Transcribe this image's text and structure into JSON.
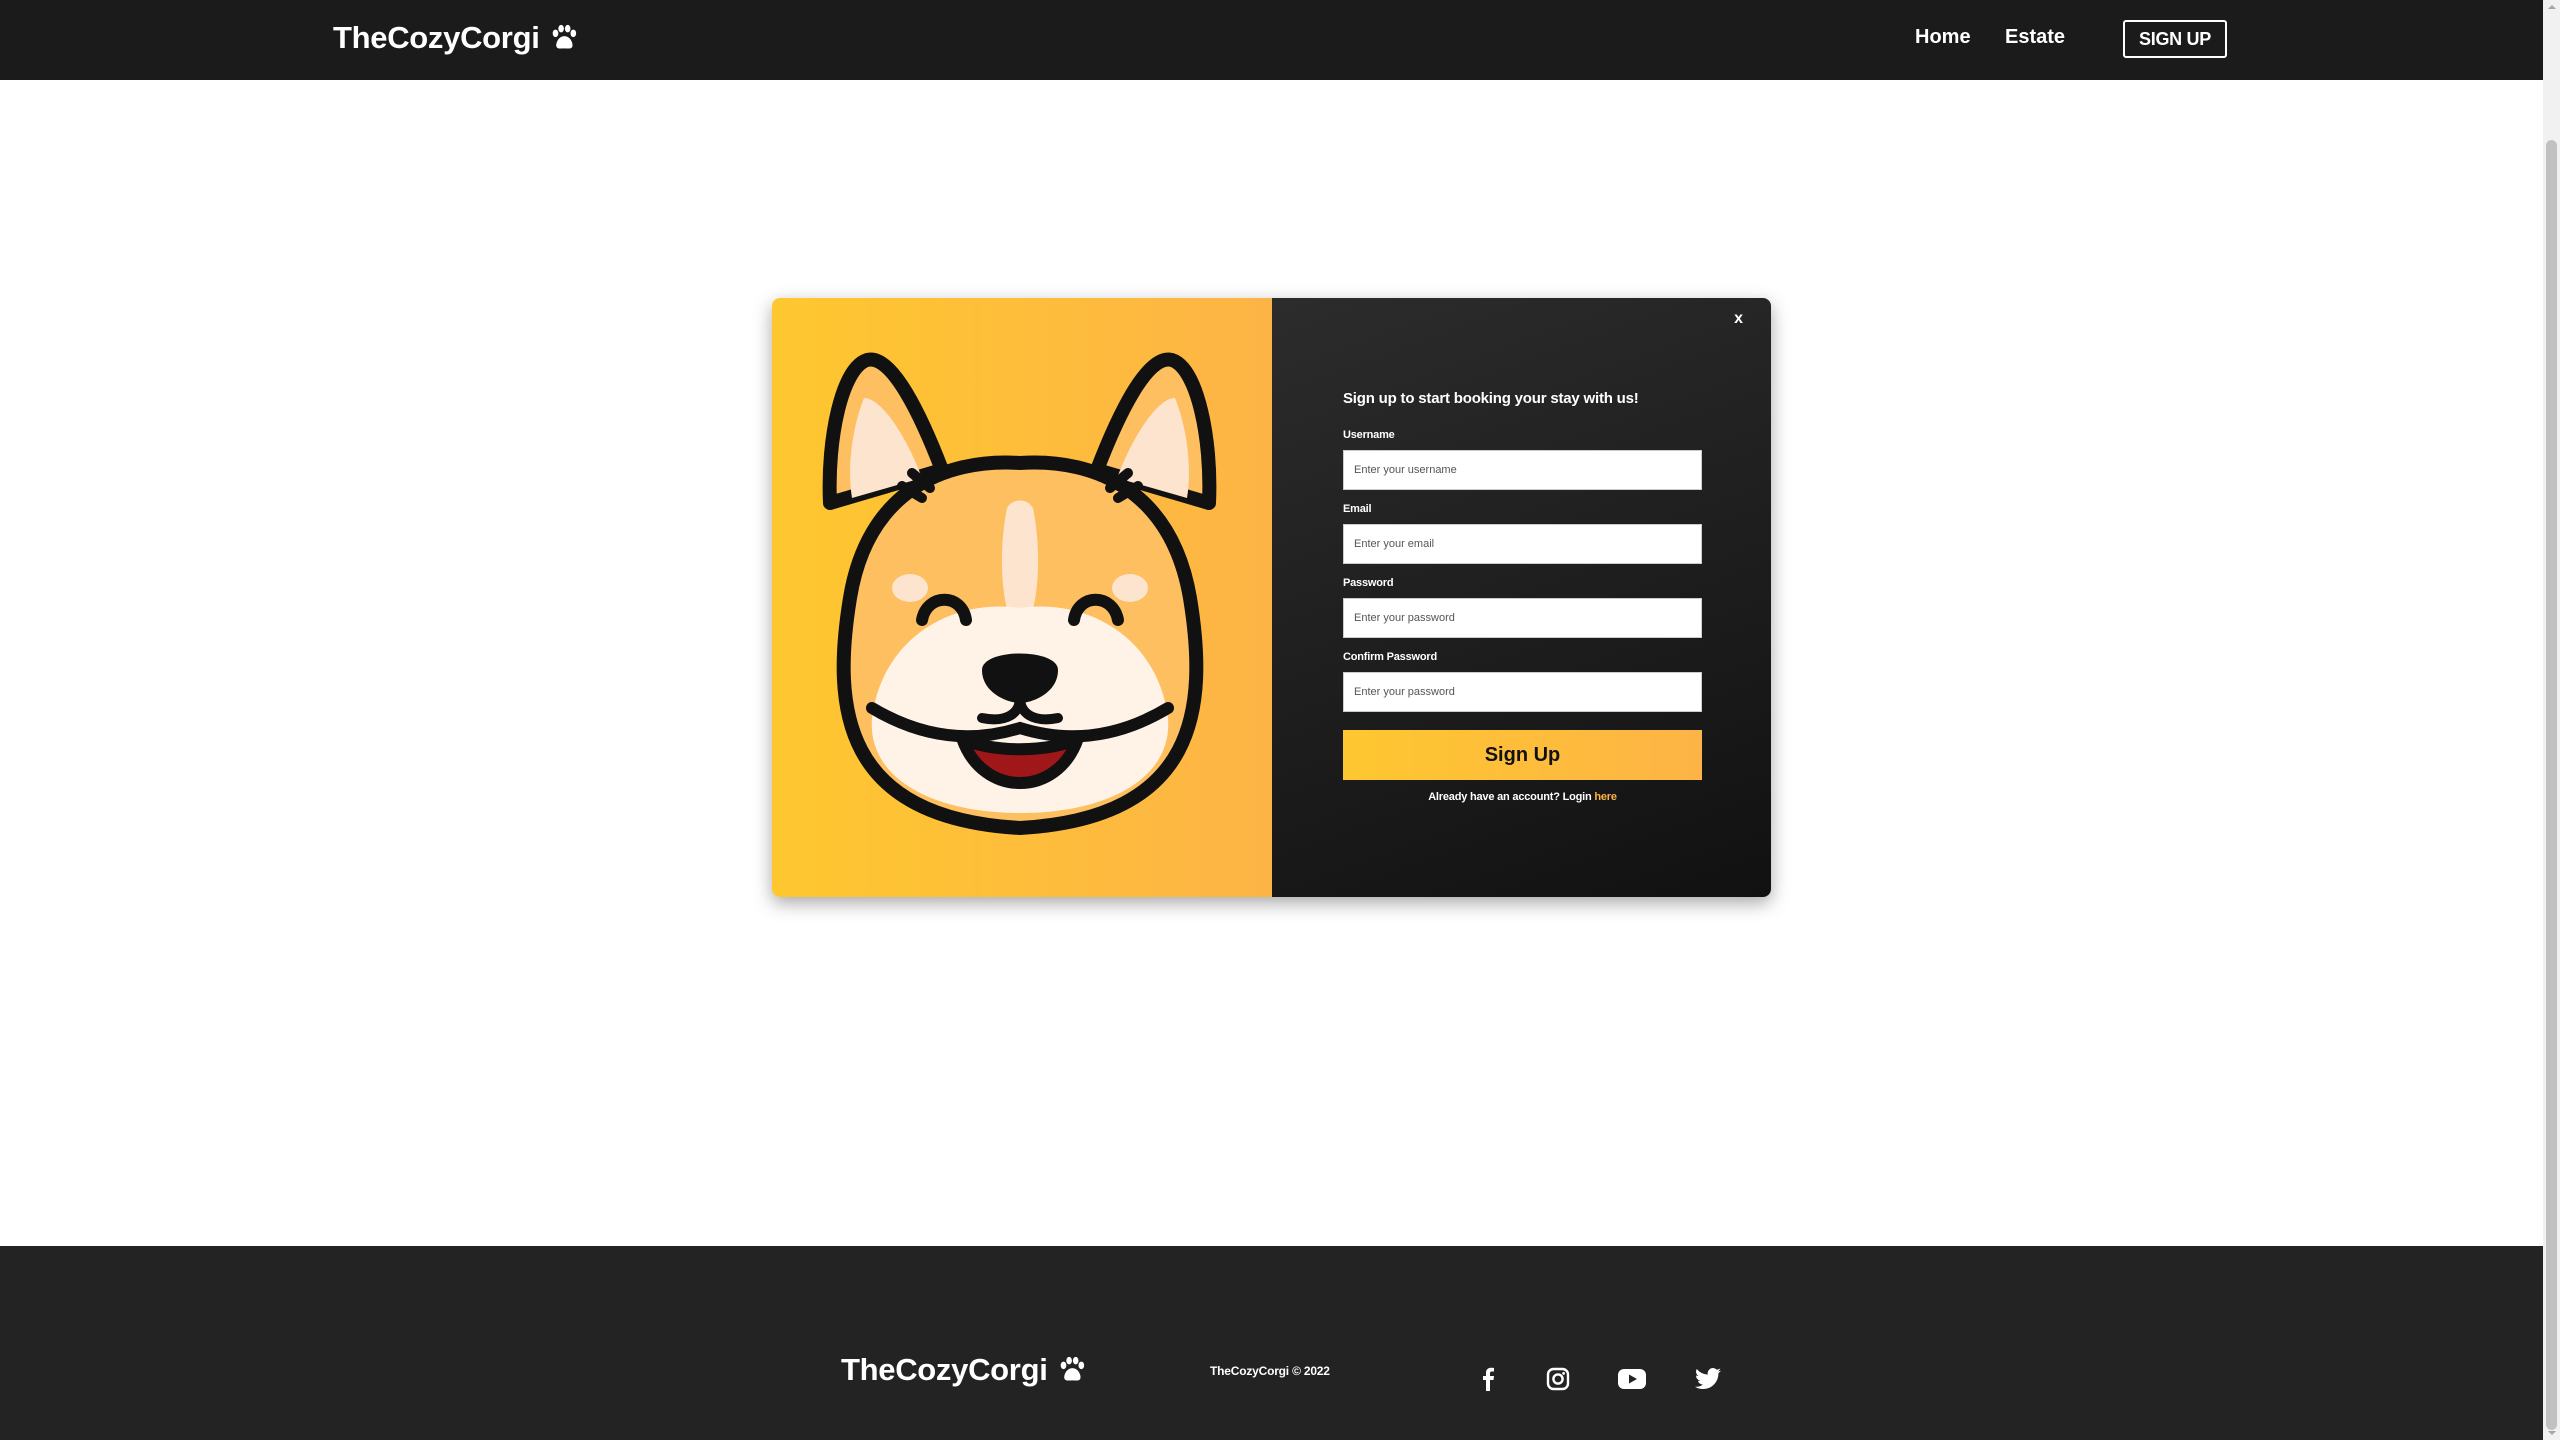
{
  "navbar": {
    "brand": "TheCozyCorgi",
    "links": [
      "Home",
      "Estate"
    ],
    "signup_label": "SIGN UP"
  },
  "modal": {
    "close_label": "x",
    "heading": "Sign up to start booking your stay with us!",
    "fields": [
      {
        "label": "Username",
        "placeholder": "Enter your username"
      },
      {
        "label": "Email",
        "placeholder": "Enter your email"
      },
      {
        "label": "Password",
        "placeholder": "Enter your password"
      },
      {
        "label": "Confirm Password",
        "placeholder": "Enter your password"
      }
    ],
    "submit_label": "Sign Up",
    "login_prompt": "Already have an account? Login",
    "login_link": "here"
  },
  "footer": {
    "brand": "TheCozyCorgi",
    "copyright": "TheCozyCorgi © 2022",
    "social_icons": [
      "facebook-icon",
      "instagram-icon",
      "youtube-icon",
      "twitter-icon"
    ]
  },
  "colors": {
    "accent_yellow": "#fec72f",
    "accent_orange": "#fdb446",
    "navbar_bg": "#1b1b1b",
    "footer_bg": "#232323",
    "link_color": "#fdb446"
  }
}
